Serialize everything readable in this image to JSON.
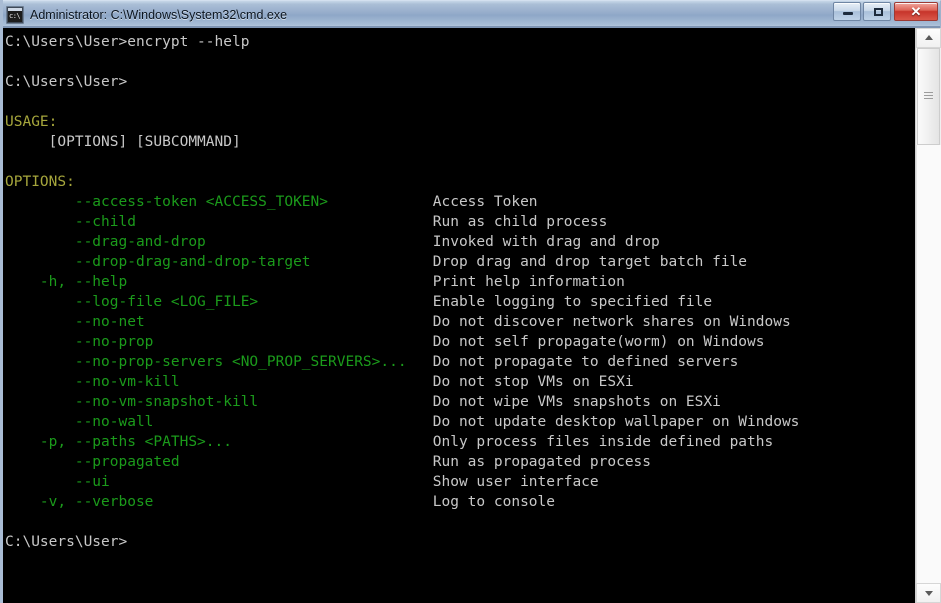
{
  "window": {
    "title": "Administrator: C:\\Windows\\System32\\cmd.exe",
    "icon_glyph": "c:\\",
    "controls": {
      "minimize_label": "–",
      "maximize_label": "□",
      "close_label": "✕"
    }
  },
  "colors": {
    "background": "#000000",
    "prompt_text": "#c8c8c8",
    "section_header": "#a6a63c",
    "option_flag": "#1b9b1b",
    "titlebar_top": "#c7d7e8",
    "titlebar_bottom": "#c3d3e6",
    "close_button": "#c7342a"
  },
  "console": {
    "lines": [
      {
        "segments": [
          {
            "text": "C:\\Users\\User>encrypt --help",
            "color": "white"
          }
        ]
      },
      {
        "segments": [
          {
            "text": "",
            "color": "white"
          }
        ]
      },
      {
        "segments": [
          {
            "text": "C:\\Users\\User>",
            "color": "white"
          }
        ]
      },
      {
        "segments": [
          {
            "text": "",
            "color": "white"
          }
        ]
      },
      {
        "segments": [
          {
            "text": "USAGE:",
            "color": "yellow"
          }
        ]
      },
      {
        "segments": [
          {
            "text": "     [OPTIONS] [SUBCOMMAND]",
            "color": "white"
          }
        ]
      },
      {
        "segments": [
          {
            "text": "",
            "color": "white"
          }
        ]
      },
      {
        "segments": [
          {
            "text": "OPTIONS:",
            "color": "yellow"
          }
        ]
      },
      {
        "segments": [
          {
            "text": "        --access-token <ACCESS_TOKEN>            ",
            "color": "green"
          },
          {
            "text": "Access Token",
            "color": "white"
          }
        ]
      },
      {
        "segments": [
          {
            "text": "        --child                                  ",
            "color": "green"
          },
          {
            "text": "Run as child process",
            "color": "white"
          }
        ]
      },
      {
        "segments": [
          {
            "text": "        --drag-and-drop                          ",
            "color": "green"
          },
          {
            "text": "Invoked with drag and drop",
            "color": "white"
          }
        ]
      },
      {
        "segments": [
          {
            "text": "        --drop-drag-and-drop-target              ",
            "color": "green"
          },
          {
            "text": "Drop drag and drop target batch file",
            "color": "white"
          }
        ]
      },
      {
        "segments": [
          {
            "text": "    -h, --help                                   ",
            "color": "green"
          },
          {
            "text": "Print help information",
            "color": "white"
          }
        ]
      },
      {
        "segments": [
          {
            "text": "        --log-file <LOG_FILE>                    ",
            "color": "green"
          },
          {
            "text": "Enable logging to specified file",
            "color": "white"
          }
        ]
      },
      {
        "segments": [
          {
            "text": "        --no-net                                 ",
            "color": "green"
          },
          {
            "text": "Do not discover network shares on Windows",
            "color": "white"
          }
        ]
      },
      {
        "segments": [
          {
            "text": "        --no-prop                                ",
            "color": "green"
          },
          {
            "text": "Do not self propagate(worm) on Windows",
            "color": "white"
          }
        ]
      },
      {
        "segments": [
          {
            "text": "        --no-prop-servers <NO_PROP_SERVERS>...   ",
            "color": "green"
          },
          {
            "text": "Do not propagate to defined servers",
            "color": "white"
          }
        ]
      },
      {
        "segments": [
          {
            "text": "        --no-vm-kill                             ",
            "color": "green"
          },
          {
            "text": "Do not stop VMs on ESXi",
            "color": "white"
          }
        ]
      },
      {
        "segments": [
          {
            "text": "        --no-vm-snapshot-kill                    ",
            "color": "green"
          },
          {
            "text": "Do not wipe VMs snapshots on ESXi",
            "color": "white"
          }
        ]
      },
      {
        "segments": [
          {
            "text": "        --no-wall                                ",
            "color": "green"
          },
          {
            "text": "Do not update desktop wallpaper on Windows",
            "color": "white"
          }
        ]
      },
      {
        "segments": [
          {
            "text": "    -p, --paths <PATHS>...                       ",
            "color": "green"
          },
          {
            "text": "Only process files inside defined paths",
            "color": "white"
          }
        ]
      },
      {
        "segments": [
          {
            "text": "        --propagated                             ",
            "color": "green"
          },
          {
            "text": "Run as propagated process",
            "color": "white"
          }
        ]
      },
      {
        "segments": [
          {
            "text": "        --ui                                     ",
            "color": "green"
          },
          {
            "text": "Show user interface",
            "color": "white"
          }
        ]
      },
      {
        "segments": [
          {
            "text": "    -v, --verbose                                ",
            "color": "green"
          },
          {
            "text": "Log to console",
            "color": "white"
          }
        ]
      },
      {
        "segments": [
          {
            "text": "",
            "color": "white"
          }
        ]
      },
      {
        "segments": [
          {
            "text": "C:\\Users\\User>",
            "color": "white"
          }
        ]
      }
    ]
  },
  "scrollbar": {
    "up_arrow": "▲",
    "down_arrow": "▼"
  }
}
